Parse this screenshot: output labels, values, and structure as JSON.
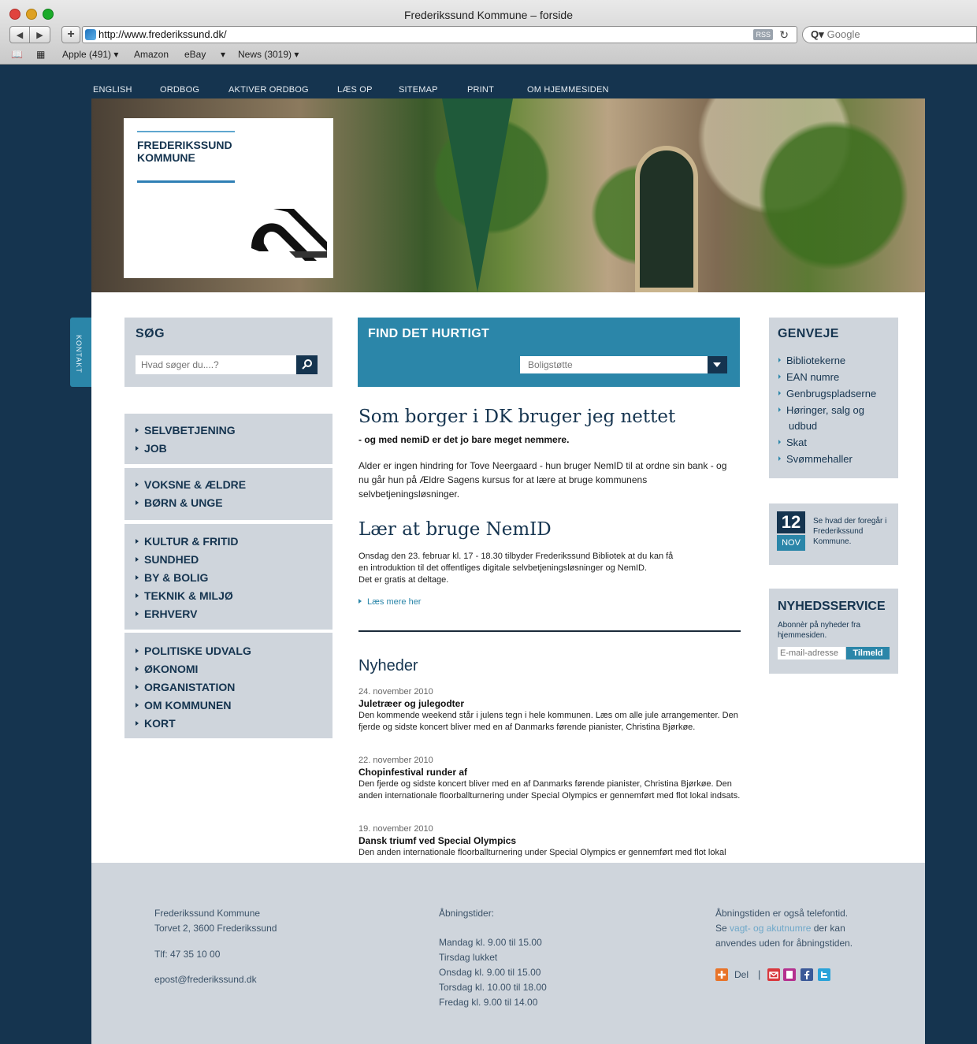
{
  "browser": {
    "window_title": "Frederikssund Kommune – forside",
    "url": "http://www.frederikssund.dk/",
    "rss_label": "RSS",
    "search_placeholder": "Google",
    "bookmarks": [
      "Apple (491) ▾",
      "Amazon",
      "eBay",
      "▾",
      "News (3019) ▾"
    ]
  },
  "topnav": [
    "ENGLISH",
    "ORDBOG",
    "AKTIVER ORDBOG",
    "LÆS OP",
    "SITEMAP",
    "PRINT",
    "OM HJEMMESIDEN"
  ],
  "logo": {
    "line1": "FREDERIKSSUND",
    "line2": "KOMMUNE"
  },
  "kontakt_label": "KONTAKT",
  "search": {
    "title": "SØG",
    "placeholder": "Hvad søger du....?"
  },
  "menu": {
    "group1": [
      "SELVBETJENING",
      "JOB"
    ],
    "group2": [
      "VOKSNE & ÆLDRE",
      "BØRN & UNGE"
    ],
    "group3": [
      "KULTUR & FRITID",
      "SUNDHED",
      "BY & BOLIG",
      "TEKNIK & MILJØ",
      "ERHVERV"
    ],
    "group4": [
      "POLITISKE UDVALG",
      "ØKONOMI",
      "ORGANISTATION",
      "OM KOMMUNEN",
      "KORT"
    ]
  },
  "find": {
    "title": "FIND DET HURTIGT",
    "selected": "Boligstøtte"
  },
  "article1": {
    "headline": "Som borger i DK bruger jeg nettet",
    "subhead": "- og med nemiD er det jo bare meget nemmere.",
    "body": "Alder er ingen hindring for Tove Neergaard - hun bruger NemID til at ordne sin bank - og nu går hun på Ældre Sagens kursus for at lære at bruge kommunens selvbetjeningsløsninger."
  },
  "article2": {
    "headline": "Lær at bruge NemID",
    "body_line1": "Onsdag den 23. februar kl. 17 - 18.30 tilbyder Frederikssund Bibliotek at du kan få",
    "body_line2": "en introduktion til det offentliges digitale selvbetjeningsløsninger og NemID.",
    "body_line3": "Det er gratis at deltage.",
    "readmore": "Læs mere her"
  },
  "news": {
    "title": "Nyheder",
    "items": [
      {
        "date": "24. november 2010",
        "headline": "Juletræer og julegodter",
        "body": "Den kommende weekend står i julens tegn i hele kommunen. Læs om alle jule arrangementer. Den fjerde og sidste koncert bliver med en af Danmarks førende pianister, Christina Bjørkøe."
      },
      {
        "date": "22. november 2010",
        "headline": "Chopinfestival runder af",
        "body": "Den fjerde og sidste koncert bliver med en af Danmarks førende pianister, Christina Bjørkøe. Den anden internationale floorballturnering under Special Olympics er gennemført med flot lokal indsats."
      },
      {
        "date": "19. november 2010",
        "headline": "Dansk triumf ved Special Olympics",
        "body": "Den anden internationale floorballturnering under Special Olympics er gennemført med flot lokal"
      }
    ]
  },
  "genveje": {
    "title": "GENVEJE",
    "items": [
      "Bibliotekerne",
      "EAN numre",
      "Genbrugspladserne",
      "Høringer, salg og udbud",
      "Skat",
      "Svømmehaller"
    ]
  },
  "calendar": {
    "day": "12",
    "month": "NOV",
    "text": "Se hvad der foregår i Frederikssund Kommune."
  },
  "nyhedsservice": {
    "title": "NYHEDSSERVICE",
    "text": "Abonnèr på nyheder fra hjemmesiden.",
    "placeholder": "E-mail-adresse",
    "button": "Tilmeld"
  },
  "footer": {
    "address1": "Frederikssund Kommune",
    "address2": "Torvet 2, 3600 Frederikssund",
    "phone": "Tlf: 47 35 10 00",
    "email": "epost@frederikssund.dk",
    "hours_title": "Åbningstider:",
    "hours": [
      "Mandag kl. 9.00 til 15.00",
      "Tirsdag lukket",
      "Onsdag kl. 9.00 til 15.00",
      "Torsdag kl. 10.00 til 18.00",
      "Fredag kl. 9.00 til 14.00"
    ],
    "note_line1": "Åbningstiden er også telefontid.",
    "note_pre": "Se ",
    "note_link": "vagt- og akutnumre",
    "note_post": " der kan",
    "note_line3": "anvendes uden for åbningstiden.",
    "share_label": "Del",
    "share_sep": "|"
  },
  "colors": {
    "navy": "#15344f",
    "accent_blue": "#2b86a9",
    "panel_grey": "#cfd5dc"
  }
}
